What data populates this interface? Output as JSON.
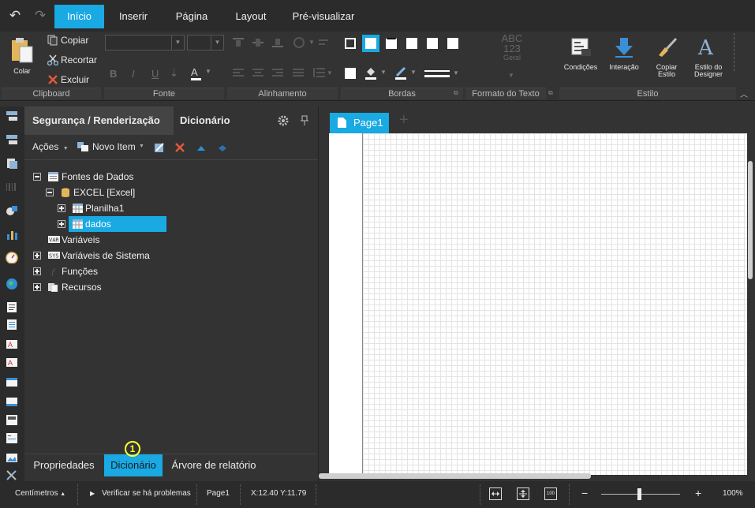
{
  "tabs": [
    {
      "label": "Início",
      "active": true
    },
    {
      "label": "Inserir",
      "active": false
    },
    {
      "label": "Página",
      "active": false
    },
    {
      "label": "Layout",
      "active": false
    },
    {
      "label": "Pré-visualizar",
      "active": false
    }
  ],
  "ribbon": {
    "clipboard": {
      "paste": "Colar",
      "copy": "Copiar",
      "cut": "Recortar",
      "delete": "Excluir"
    },
    "format_box": {
      "line1": "ABC",
      "line2": "123",
      "line3": "Geral"
    },
    "style_buttons": {
      "conditions": "Condições",
      "interaction": "Interação",
      "copy_style": [
        "Copiar",
        "Estilo"
      ],
      "designer_style": [
        "Estilo do",
        "Designer"
      ]
    },
    "groups": [
      "Clipboard",
      "Fonte",
      "Alinhamento",
      "Bordas",
      "Formato do Texto",
      "Estilo"
    ]
  },
  "panel": {
    "tabs": [
      "Segurança / Renderização",
      "Dicionário"
    ],
    "actions": {
      "actions": "Ações",
      "new_item": "Novo Item"
    },
    "tree": {
      "data_sources": "Fontes de Dados",
      "excel": "EXCEL [Excel]",
      "sheet1": "Planilha1",
      "dados": "dados",
      "variables": "Variáveis",
      "system_variables": "Variáveis de Sistema",
      "functions": "Funções",
      "resources": "Recursos"
    },
    "bottom_tabs": [
      "Propriedades",
      "Dicionário",
      "Árvore de relatório"
    ]
  },
  "design": {
    "page_tab": "Page1"
  },
  "status": {
    "units": "Centímetros",
    "check": "Verificar se há problemas",
    "page": "Page1",
    "coords": "X:12.40 Y:11.79",
    "zoom": "100%",
    "zoom_level": 1.0,
    "fit_label": "100"
  },
  "marker": "1",
  "colors": {
    "accent": "#19a9e3",
    "bg": "#333333",
    "marker": "#ffff33"
  }
}
